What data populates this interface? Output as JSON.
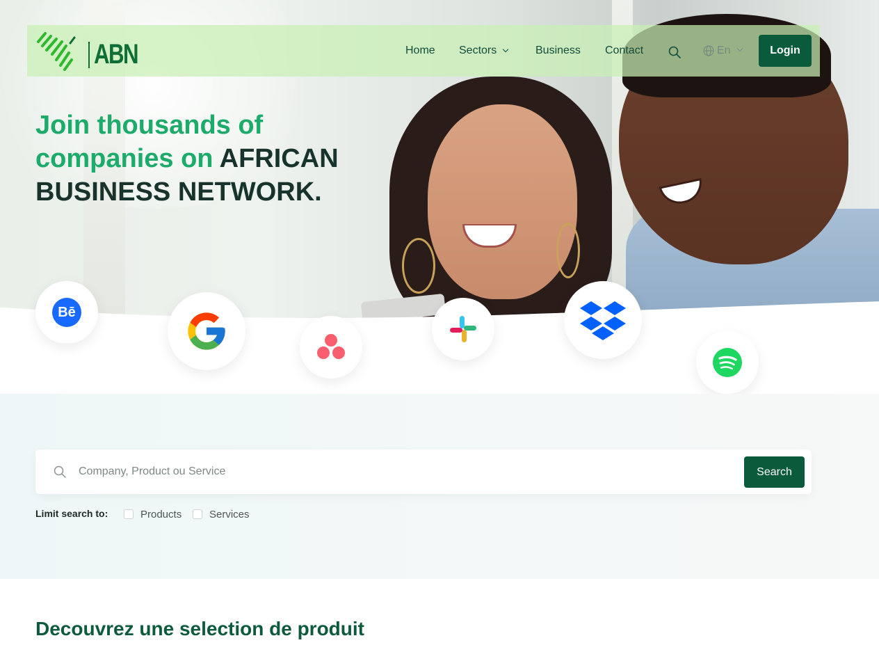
{
  "nav": {
    "logo_text": "ABN",
    "links": [
      {
        "label": "Home"
      },
      {
        "label": "Sectors"
      },
      {
        "label": "Business"
      },
      {
        "label": "Contact"
      }
    ],
    "language": "En",
    "login_label": "Login"
  },
  "hero": {
    "headline_green": "Join thousands of companies on",
    "headline_dark": "AFRICAN BUSINESS NETWORK."
  },
  "brands": [
    "behance-icon",
    "google-icon",
    "asana-icon",
    "slack-icon",
    "dropbox-icon",
    "spotify-icon"
  ],
  "brand_labels": {
    "behance": "Bē"
  },
  "search": {
    "placeholder": "Company, Product ou Service",
    "button_label": "Search",
    "limit_label": "Limit search to:",
    "options": [
      {
        "label": "Products",
        "checked": false
      },
      {
        "label": "Services",
        "checked": false
      }
    ]
  },
  "section": {
    "title": "Decouvrez une selection de produit"
  },
  "colors": {
    "primary": "#0a5a3c",
    "accent_green": "#1cab6a",
    "nav_bg": "#c8f0b4"
  }
}
